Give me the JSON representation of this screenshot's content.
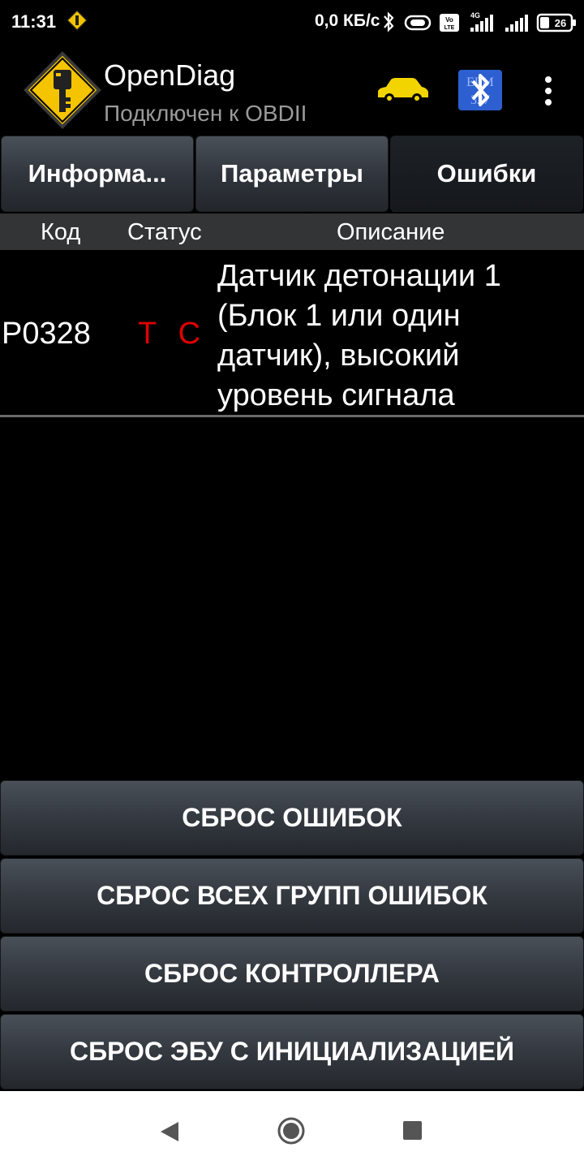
{
  "status_bar": {
    "time": "11:31",
    "speed": "0,0 КБ/с",
    "battery": "26",
    "network": "4G",
    "volte": "Vo LTE"
  },
  "app_bar": {
    "title": "OpenDiag",
    "subtitle": "Подключен к OBDII",
    "logo_icon": "key-warning-icon",
    "car_icon": "car-icon",
    "bluetooth_icon": "bluetooth-elm327-icon",
    "menu_icon": "overflow-menu-icon",
    "bluetooth_badge": "ELM 327"
  },
  "tabs": [
    {
      "label": "Информа..."
    },
    {
      "label": "Параметры"
    },
    {
      "label": "Ошибки",
      "active": true
    }
  ],
  "list_header": {
    "code": "Код",
    "status": "Статус",
    "description": "Описание"
  },
  "errors": [
    {
      "code": "P0328",
      "status": "T  C",
      "description": "Датчик детонации 1 (Блок 1 или один датчик), высокий уровень сигнала"
    }
  ],
  "buttons": {
    "reset_errors": "СБРОС ОШИБОК",
    "reset_all_groups": "СБРОС ВСЕХ ГРУПП ОШИБОК",
    "reset_controller": "СБРОС КОНТРОЛЛЕРА",
    "reset_ecu_init": "СБРОС ЭБУ С ИНИЦИАЛИЗАЦИЕЙ"
  },
  "colors": {
    "status_red": "#e00000",
    "logo_yellow": "#f5c400",
    "car_yellow": "#f2d400",
    "bt_blue": "#2d5fd0"
  }
}
